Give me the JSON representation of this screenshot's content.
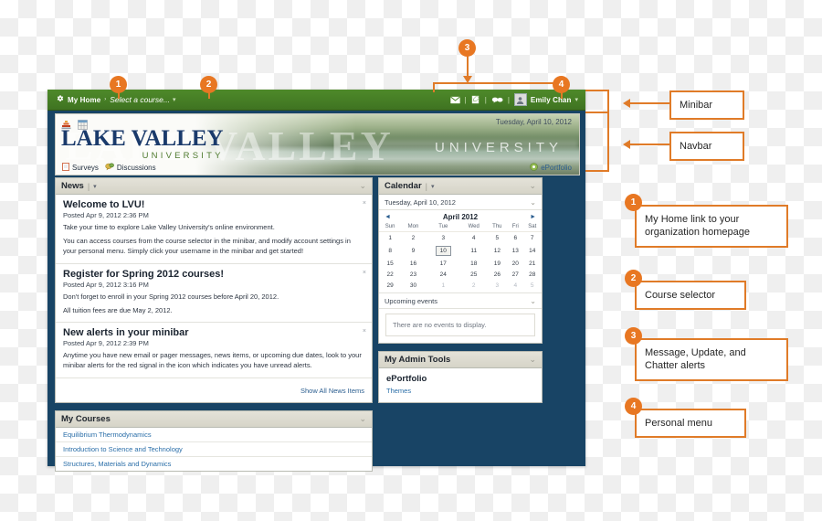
{
  "minibar": {
    "home_label": "My Home",
    "home_icon": "puzzle-icon",
    "breadcrumb_chevron": "›",
    "course_selector_label": "Select a course...",
    "caret": "▾",
    "alerts": [
      {
        "name": "message-alert-icon",
        "glyph": "✉"
      },
      {
        "name": "update-alert-icon",
        "glyph": "✎"
      },
      {
        "name": "chatter-alert-icon",
        "glyph": "••"
      }
    ],
    "separator": "|",
    "user_name": "Emily Chan"
  },
  "navbar": {
    "date": "Tuesday, April 10, 2012",
    "logo_line1": "LAKE VALLEY",
    "logo_line2": "UNIVERSITY",
    "watermark": "LAKE VALLEY",
    "watermark_sub": "UNIVERSITY",
    "icons": [
      {
        "name": "hierarchy-icon"
      },
      {
        "name": "table-grid-icon"
      }
    ],
    "links": [
      {
        "label": "Surveys",
        "icon": "survey-icon"
      },
      {
        "label": "Discussions",
        "icon": "discussions-icon"
      }
    ],
    "eportfolio_label": "ePortfolio",
    "eportfolio_icon": "eportfolio-icon"
  },
  "news": {
    "title": "News",
    "caret": "▾",
    "collapse": "⌄",
    "items": [
      {
        "title": "Welcome to LVU!",
        "posted": "Posted Apr 9, 2012 2:36 PM",
        "paragraphs": [
          "Take your time to explore Lake Valley University's online environment.",
          "You can access courses from the course selector in the minibar, and modify account settings in your personal menu. Simply click your username in the minibar and get started!"
        ],
        "close": "×"
      },
      {
        "title": "Register for Spring 2012 courses!",
        "posted": "Posted Apr 9, 2012 3:16 PM",
        "paragraphs": [
          "Don't forget to enroll in your Spring 2012 courses before April 20, 2012.",
          "All tuition fees are due May 2, 2012."
        ],
        "close": "×"
      },
      {
        "title": "New alerts in your minibar",
        "posted": "Posted Apr 9, 2012 2:39 PM",
        "paragraphs": [
          "Anytime you have new email or pager messages, news items, or upcoming due dates, look to your minibar alerts for the red signal in the icon which indicates you have unread alerts."
        ],
        "close": "×"
      }
    ],
    "show_all_label": "Show All News Items"
  },
  "my_courses": {
    "title": "My Courses",
    "collapse": "⌄",
    "courses": [
      "Equilibrium Thermodynamics",
      "Introduction to Science and Technology",
      "Structures, Materials and Dynamics"
    ]
  },
  "calendar": {
    "title": "Calendar",
    "caret": "▾",
    "collapse": "⌄",
    "current_date": "Tuesday, April 10, 2012",
    "prev_arrow": "◄",
    "next_arrow": "►",
    "month_label": "April 2012",
    "weekdays": [
      "Sun",
      "Mon",
      "Tue",
      "Wed",
      "Thu",
      "Fri",
      "Sat"
    ],
    "weeks": [
      [
        {
          "d": "1"
        },
        {
          "d": "2"
        },
        {
          "d": "3"
        },
        {
          "d": "4"
        },
        {
          "d": "5"
        },
        {
          "d": "6"
        },
        {
          "d": "7"
        }
      ],
      [
        {
          "d": "8"
        },
        {
          "d": "9"
        },
        {
          "d": "10",
          "today": true
        },
        {
          "d": "11"
        },
        {
          "d": "12"
        },
        {
          "d": "13"
        },
        {
          "d": "14"
        }
      ],
      [
        {
          "d": "15"
        },
        {
          "d": "16"
        },
        {
          "d": "17"
        },
        {
          "d": "18"
        },
        {
          "d": "19"
        },
        {
          "d": "20"
        },
        {
          "d": "21"
        }
      ],
      [
        {
          "d": "22"
        },
        {
          "d": "23"
        },
        {
          "d": "24"
        },
        {
          "d": "25"
        },
        {
          "d": "26"
        },
        {
          "d": "27"
        },
        {
          "d": "28"
        }
      ],
      [
        {
          "d": "29"
        },
        {
          "d": "30"
        },
        {
          "d": "1",
          "other": true
        },
        {
          "d": "2",
          "other": true
        },
        {
          "d": "3",
          "other": true
        },
        {
          "d": "4",
          "other": true
        },
        {
          "d": "5",
          "other": true
        }
      ]
    ],
    "upcoming_label": "Upcoming events",
    "no_events_text": "There are no events to display."
  },
  "admin_tools": {
    "title": "My Admin Tools",
    "collapse": "⌄",
    "group_label": "ePortfolio",
    "link_label": "Themes"
  },
  "annotations": {
    "accent_color": "#e07b28",
    "badge_color": "#e87722",
    "labels": [
      {
        "id": "minibar",
        "text": "Minibar"
      },
      {
        "id": "navbar",
        "text": "Navbar"
      }
    ],
    "numbered": [
      {
        "num": "1",
        "text": "My Home link to your organization homepage"
      },
      {
        "num": "2",
        "text": "Course selector"
      },
      {
        "num": "3",
        "text": "Message, Update, and Chatter alerts"
      },
      {
        "num": "4",
        "text": "Personal menu"
      }
    ]
  }
}
